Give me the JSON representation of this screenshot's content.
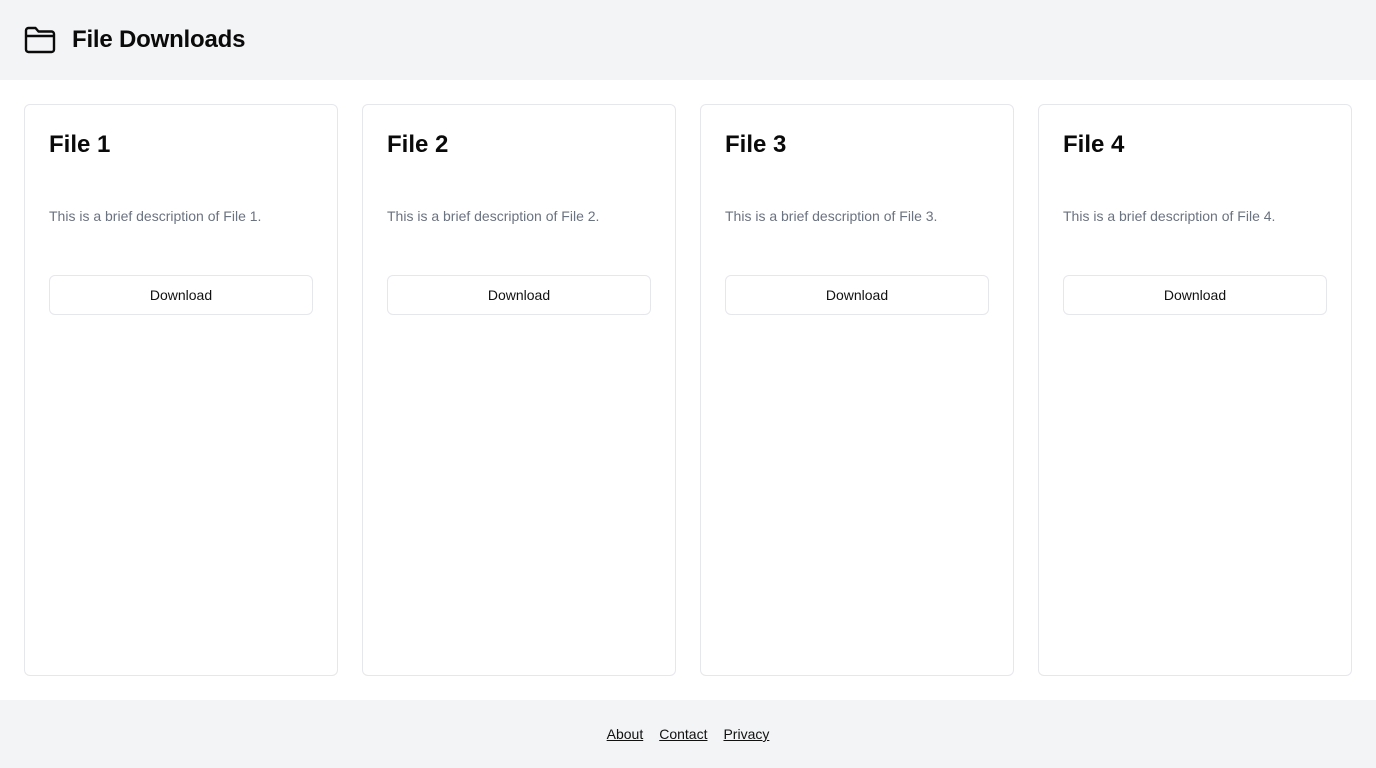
{
  "header": {
    "title": "File Downloads",
    "icon": "folder-icon"
  },
  "files": [
    {
      "title": "File 1",
      "description": "This is a brief description of File 1.",
      "button_label": "Download"
    },
    {
      "title": "File 2",
      "description": "This is a brief description of File 2.",
      "button_label": "Download"
    },
    {
      "title": "File 3",
      "description": "This is a brief description of File 3.",
      "button_label": "Download"
    },
    {
      "title": "File 4",
      "description": "This is a brief description of File 4.",
      "button_label": "Download"
    }
  ],
  "footer": {
    "links": [
      "About",
      "Contact",
      "Privacy"
    ]
  },
  "colors": {
    "header_bg": "#f3f4f6",
    "footer_bg": "#f3f4f6",
    "card_border": "#e5e7eb",
    "description_text": "#6b7280"
  }
}
